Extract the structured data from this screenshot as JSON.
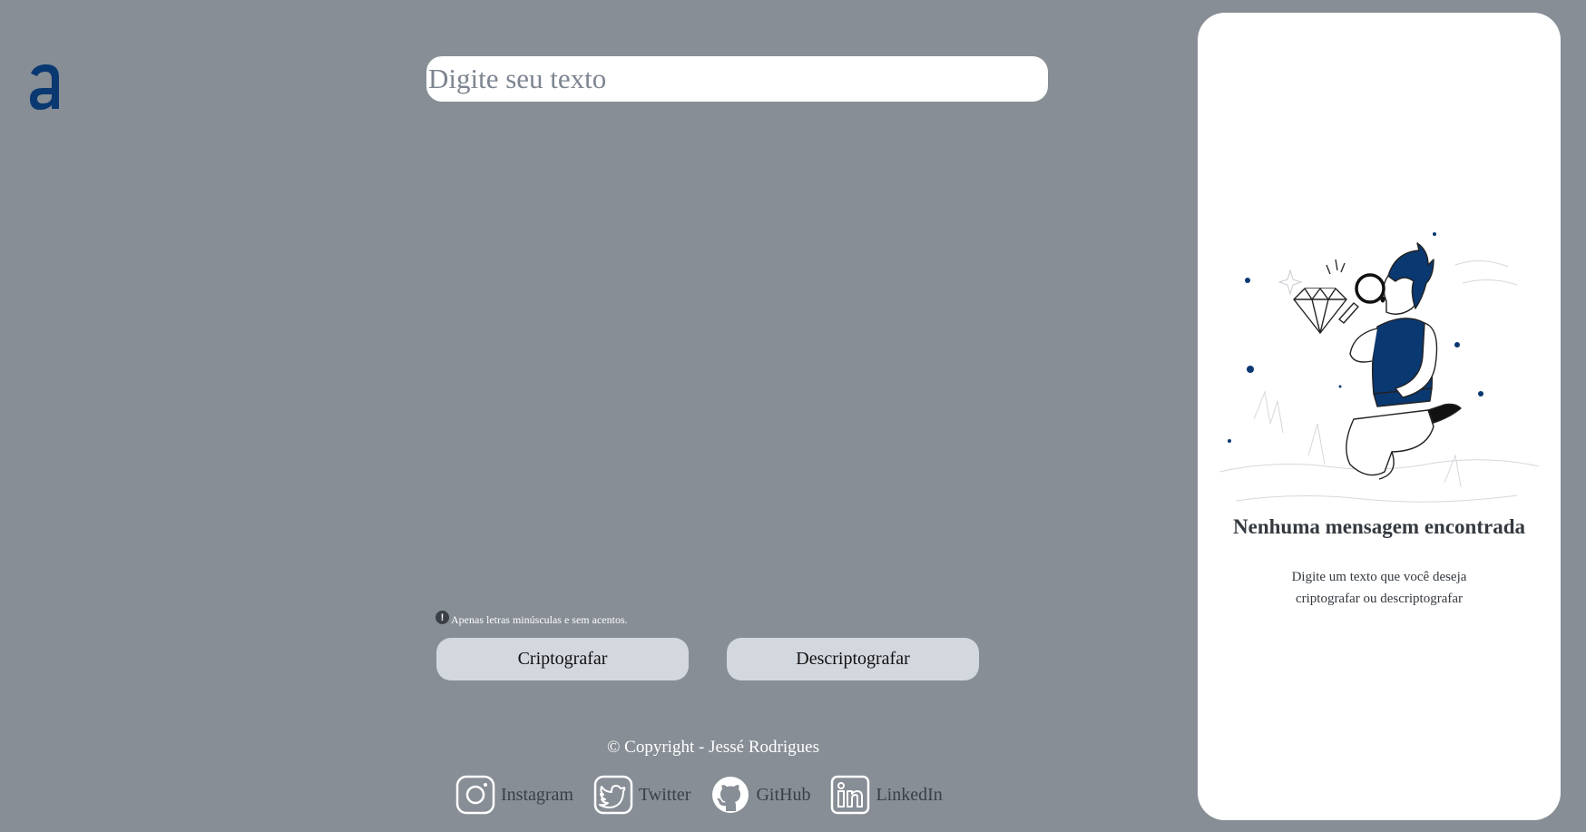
{
  "logo": {
    "letter": "a"
  },
  "input": {
    "placeholder": "Digite seu texto",
    "value": ""
  },
  "hint": {
    "icon": "exclamation-circle-icon",
    "text": "Apenas letras minúsculas e sem acentos."
  },
  "buttons": {
    "encrypt_label": "Criptografar",
    "decrypt_label": "Descriptografar"
  },
  "footer": {
    "copyright": "© Copyright - Jessé Rodrigues",
    "socials": [
      {
        "label": "Instagram",
        "icon": "instagram-icon"
      },
      {
        "label": "Twitter",
        "icon": "twitter-icon"
      },
      {
        "label": "GitHub",
        "icon": "github-icon"
      },
      {
        "label": "LinkedIn",
        "icon": "linkedin-icon"
      }
    ]
  },
  "output_panel": {
    "title": "Nenhuma mensagem encontrada",
    "subtitle": "Digite um texto que você deseja criptografar ou descriptografar",
    "illustration": "person-with-magnifying-glass-and-diamond"
  },
  "colors": {
    "background": "#878e95",
    "accent": "#0a3871",
    "button": "#d3d7de",
    "panel": "#ffffff"
  }
}
